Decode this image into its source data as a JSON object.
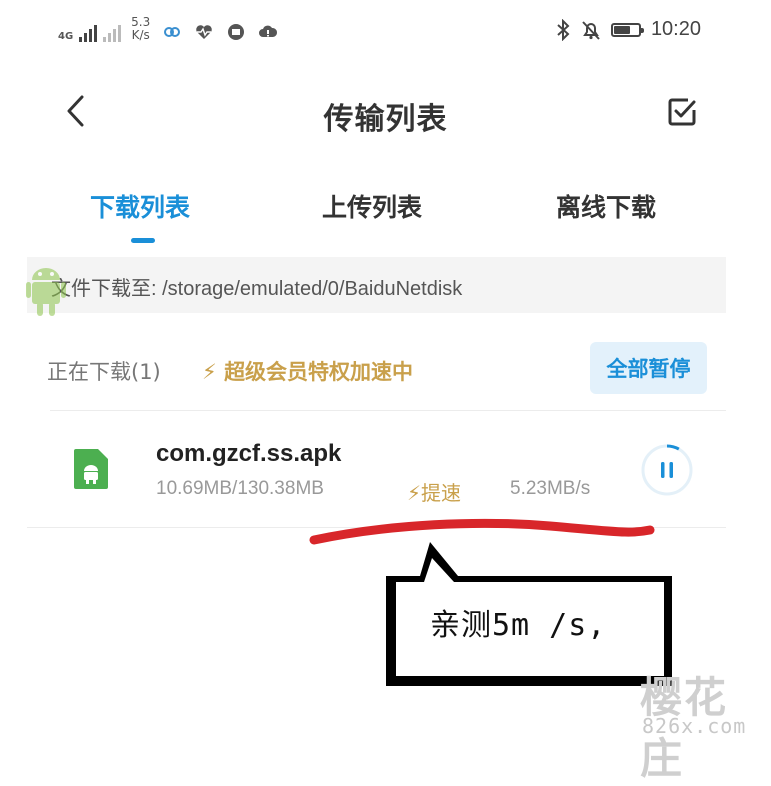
{
  "status_bar": {
    "network": "4G",
    "speed_value": "5.3",
    "speed_unit": "K/s",
    "time": "10:20"
  },
  "header": {
    "title": "传输列表"
  },
  "tabs": [
    {
      "label": "下载列表",
      "active": true
    },
    {
      "label": "上传列表",
      "active": false
    },
    {
      "label": "离线下载",
      "active": false
    }
  ],
  "path_bar": {
    "text": "文件下载至: /storage/emulated/0/BaiduNetdisk"
  },
  "section": {
    "downloading_label": "正在下载(1)",
    "vip_label": "超级会员特权加速中",
    "pause_all_label": "全部暂停"
  },
  "downloads": [
    {
      "filename": "com.gzcf.ss.apk",
      "size": "10.69MB/130.38MB",
      "accelerate_label": "提速",
      "speed": "5.23MB/s",
      "progress": 0.082
    }
  ],
  "annotation": {
    "bubble_text": "亲测5m /s,"
  },
  "watermark": {
    "big": "樱花庄",
    "small": "826x.com"
  },
  "colors": {
    "accent": "#1a8fd8",
    "vip_gold": "#c9a04b",
    "apk_green": "#4caf50",
    "scribble_red": "#d8262a"
  }
}
